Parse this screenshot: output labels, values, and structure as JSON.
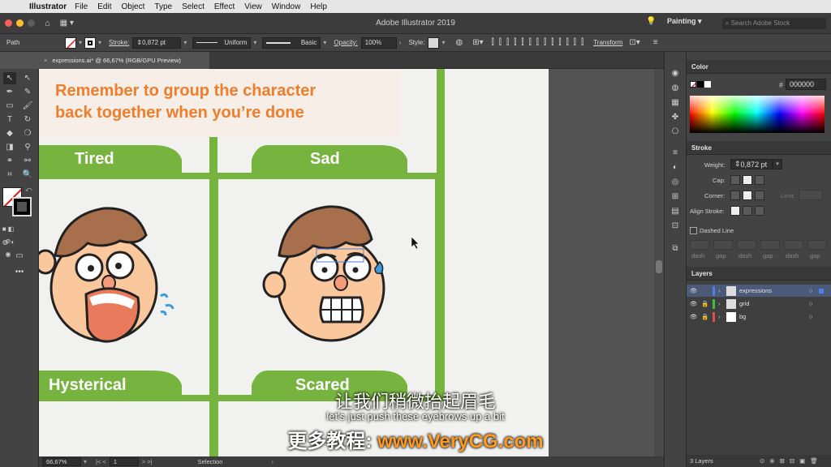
{
  "menubar": {
    "app": "Illustrator",
    "items": [
      "File",
      "Edit",
      "Object",
      "Type",
      "Select",
      "Effect",
      "View",
      "Window",
      "Help"
    ]
  },
  "appbar": {
    "title": "Adobe Illustrator 2019",
    "workspace": "Painting",
    "search_placeholder": "Search Adobe Stock"
  },
  "control": {
    "selection_type": "Path",
    "stroke_label": "Stroke:",
    "stroke_value": "0,872 pt",
    "profile": "Uniform",
    "brush": "Basic",
    "opacity_label": "Opacity:",
    "opacity_value": "100%",
    "style_label": "Style:",
    "transform": "Transform"
  },
  "document": {
    "tab": "expressions.ai* @ 66,67% (RGB/GPU Preview)"
  },
  "artboard": {
    "note_line1": "Remember to group the character",
    "note_line2": "back together when you’re done",
    "labels": [
      "Tired",
      "Sad",
      "Hysterical",
      "Scared"
    ],
    "green": "#76b43f",
    "orange": "#ef7d2b"
  },
  "status": {
    "zoom": "66,67%",
    "artboard": "1",
    "tool": "Selection"
  },
  "color_panel": {
    "title": "Color",
    "hex": "000000"
  },
  "stroke_panel": {
    "title": "Stroke",
    "weight_label": "Weight:",
    "weight_value": "0,872 pt",
    "cap_label": "Cap:",
    "corner_label": "Corner:",
    "limit_label": "Limit:",
    "align_label": "Align Stroke:",
    "dashed_label": "Dashed Line",
    "dash_labels": [
      "dash",
      "gap",
      "dash",
      "gap",
      "dash",
      "gap"
    ]
  },
  "layers_panel": {
    "title": "Layers",
    "layers": [
      {
        "name": "expressions",
        "color": "#4f7fe0"
      },
      {
        "name": "grid",
        "color": "#3fbf3f"
      },
      {
        "name": "bg",
        "color": "#e04f4f"
      }
    ],
    "count": "3 Layers"
  },
  "subtitles": {
    "zh": "让我们稍微抬起眉毛",
    "en": "let's just push these eyebrows up a bit",
    "brand_zh": "更多教程:",
    "brand_url": "www.VeryCG.com"
  }
}
